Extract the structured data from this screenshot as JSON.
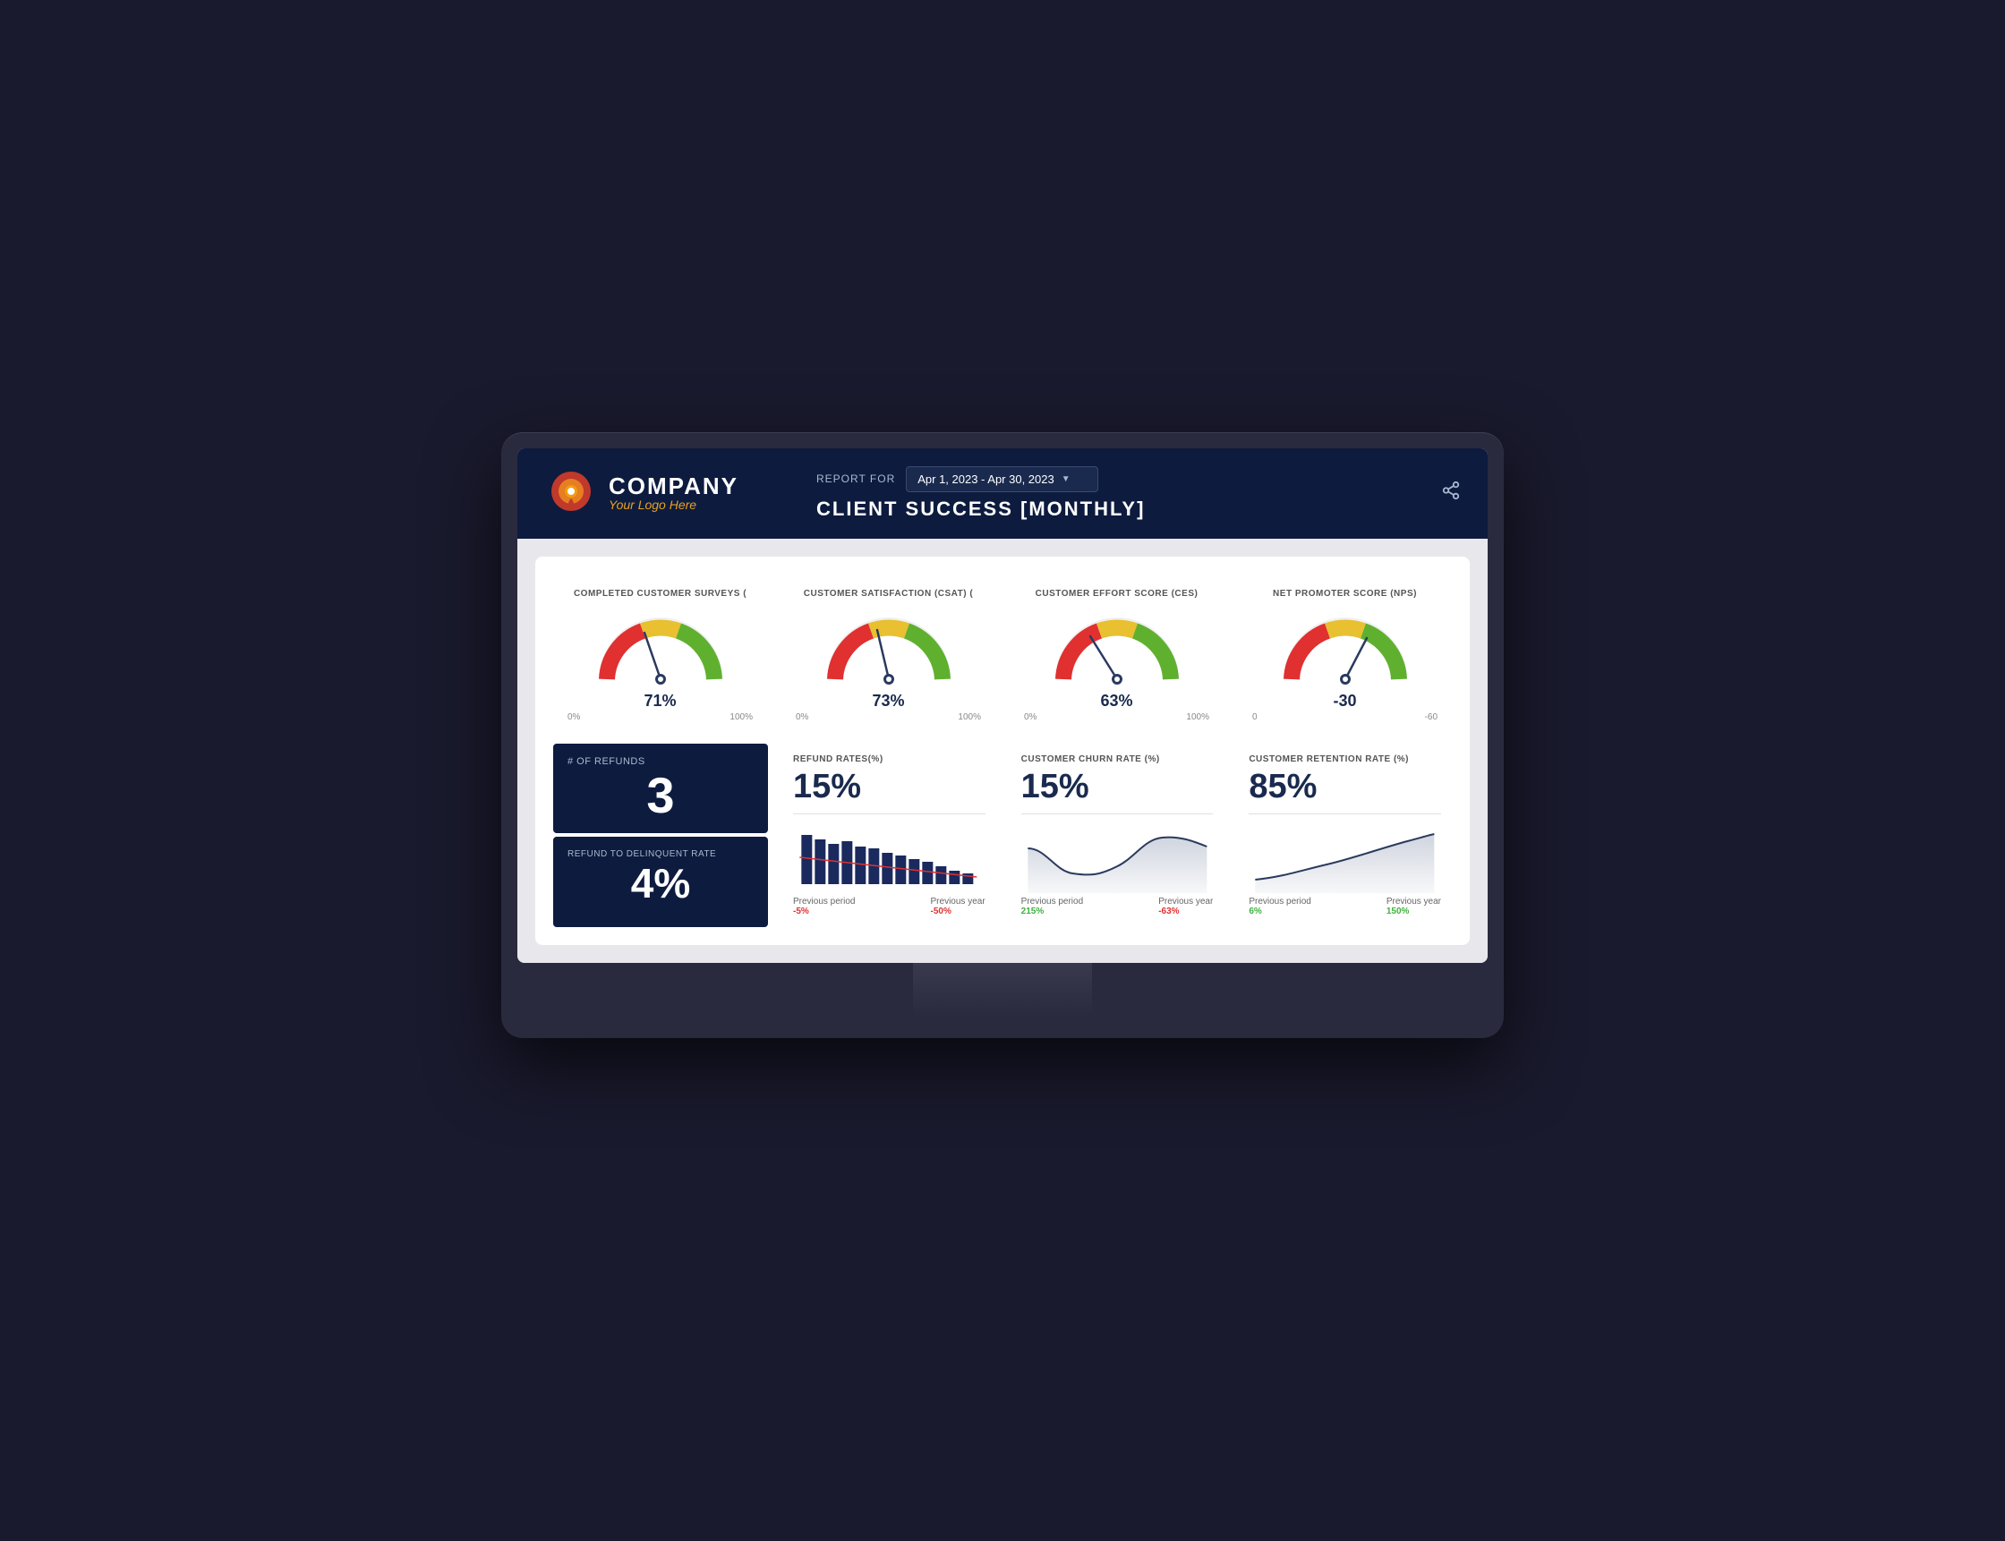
{
  "monitor": {
    "header": {
      "report_for_label": "REPORT FOR",
      "date_range": "Apr 1, 2023 - Apr 30, 2023",
      "title": "CLIENT SUCCESS [MONTHLY]",
      "company_name": "COMPANY",
      "logo_tagline": "Your Logo Here"
    },
    "gauges": [
      {
        "title": "COMPLETED CUSTOMER SURVEYS (",
        "value": "71%",
        "label_left": "0%",
        "label_right": "100%",
        "needle_angle": -15,
        "pct": 0.71
      },
      {
        "title": "CUSTOMER SATISFACTION (CSAT) (",
        "value": "73%",
        "label_left": "0%",
        "label_right": "100%",
        "needle_angle": -10,
        "pct": 0.73
      },
      {
        "title": "CUSTOMER EFFORT SCORE (CES)",
        "value": "63%",
        "label_left": "0%",
        "label_right": "100%",
        "needle_angle": -25,
        "pct": 0.63
      },
      {
        "title": "NET PROMOTER SCORE (NPS)",
        "value": "-30",
        "label_left": "0",
        "label_right": "-60",
        "needle_angle": 35,
        "pct": 0.5
      }
    ],
    "metrics": [
      {
        "id": "refunds",
        "label": "# OF REFUNDS",
        "value": "3"
      },
      {
        "id": "delinquent",
        "label": "REFUND TO DELINQUENT RATE",
        "value": "4%"
      },
      {
        "id": "refund_rate",
        "title": "REFUND RATES(%)",
        "value": "15%",
        "prev_period_label": "Previous period",
        "prev_period_val": "-5%",
        "prev_period_color": "neg",
        "prev_year_label": "Previous year",
        "prev_year_val": "-50%",
        "prev_year_color": "neg",
        "chart_type": "bar"
      },
      {
        "id": "churn_rate",
        "title": "CUSTOMER CHURN RATE (%)",
        "value": "15%",
        "prev_period_label": "Previous period",
        "prev_period_val": "215%",
        "prev_period_color": "pos",
        "prev_year_label": "Previous year",
        "prev_year_val": "-63%",
        "prev_year_color": "neg",
        "chart_type": "line"
      },
      {
        "id": "retention_rate",
        "title": "CUSTOMER RETENTION RATE (%)",
        "value": "85%",
        "prev_period_label": "Previous period",
        "prev_period_val": "6%",
        "prev_period_color": "pos",
        "prev_year_label": "Previous year",
        "prev_year_val": "150%",
        "prev_year_color": "pos",
        "chart_type": "area"
      }
    ]
  }
}
